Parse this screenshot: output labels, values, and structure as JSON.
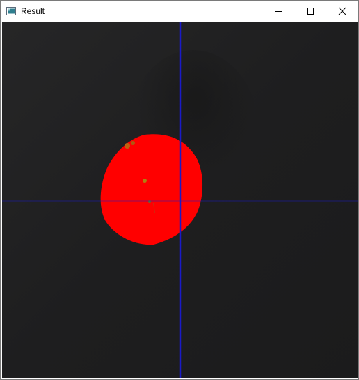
{
  "window": {
    "title": "Result"
  },
  "icons": {
    "app": "app-window-icon",
    "minimize": "minimize-icon",
    "maximize": "maximize-icon",
    "close": "close-icon"
  },
  "image": {
    "background_color": "#1e1e1f",
    "blob_color": "#ff0000",
    "crosshair_color": "#1a1ac8"
  }
}
